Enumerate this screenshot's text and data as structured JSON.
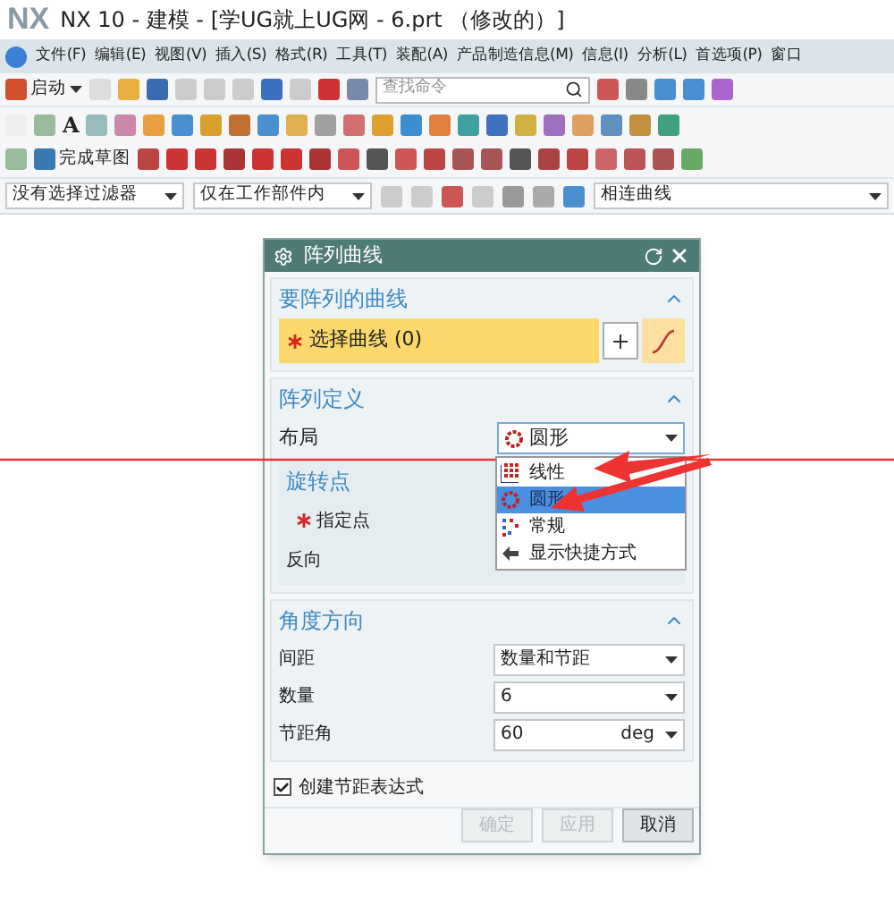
{
  "window": {
    "app": "NX",
    "title": "NX 10 - 建模 - [学UG就上UG网 - 6.prt （修改的）]"
  },
  "menu": [
    "文件(F)",
    "编辑(E)",
    "视图(V)",
    "插入(S)",
    "格式(R)",
    "工具(T)",
    "装配(A)",
    "产品制造信息(M)",
    "信息(I)",
    "分析(L)",
    "首选项(P)",
    "窗口"
  ],
  "toolbar": {
    "text_tool": "A",
    "start": "启动",
    "search_placeholder": "查找命令",
    "finish_sketch": "完成草图"
  },
  "filters": [
    "没有选择过滤器",
    "仅在工作部件内",
    "相连曲线"
  ],
  "dialog": {
    "title": "阵列曲线",
    "curves": {
      "heading": "要阵列的曲线",
      "expanded": true,
      "select_label": "选择曲线 (0)"
    },
    "definition": {
      "heading": "阵列定义",
      "expanded": true,
      "layout_label": "布局",
      "layout_value": "圆形",
      "open": true,
      "options": [
        {
          "label": "线性",
          "kind": "linear",
          "selected": false
        },
        {
          "label": "圆形",
          "kind": "circular",
          "selected": true
        },
        {
          "label": "常规",
          "kind": "general",
          "selected": false
        },
        {
          "label": "显示快捷方式",
          "kind": "shortcut",
          "selected": false
        }
      ],
      "pivot_heading": "旋转点",
      "point_label": "指定点",
      "reverse_label": "反向"
    },
    "angle": {
      "heading": "角度方向",
      "expanded": true,
      "rows": [
        {
          "label": "间距",
          "value": "数量和节距"
        },
        {
          "label": "数量",
          "value": "6"
        },
        {
          "label": "节距角",
          "value": "60",
          "unit": "deg"
        }
      ]
    },
    "create_expression": {
      "label": "创建节距表达式",
      "checked": true
    },
    "buttons": [
      {
        "label": "确定",
        "disabled": true
      },
      {
        "label": "应用",
        "disabled": true
      },
      {
        "label": "取消",
        "disabled": false
      }
    ]
  }
}
